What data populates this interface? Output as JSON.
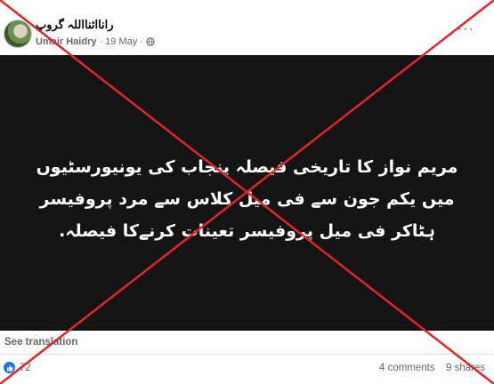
{
  "post": {
    "group_name": "رانااثنااللہ گروپ",
    "author": "Umair Haidry",
    "date": "19 May",
    "separator": "·",
    "more_label": "···"
  },
  "media": {
    "caption_lines": [
      "مریم نواز کا تاریخی فیصلہ پنجاب کی یونیورسٹیوں",
      "میں یکم جون سے فی میل کلاس سے مرد پروفیسر",
      "ہٹاکر فی میل پروفیسر تعینات کرنےکا فیصلہ."
    ]
  },
  "footer": {
    "see_translation": "See translation",
    "reaction_count": "72",
    "comments": "4 comments",
    "shares": "9 shares"
  },
  "icons": {
    "like": "like-icon",
    "globe": "globe-icon",
    "more": "more-icon"
  },
  "colors": {
    "cross": "#e0262b",
    "like": "#1877f2",
    "media_bg": "#141414"
  }
}
